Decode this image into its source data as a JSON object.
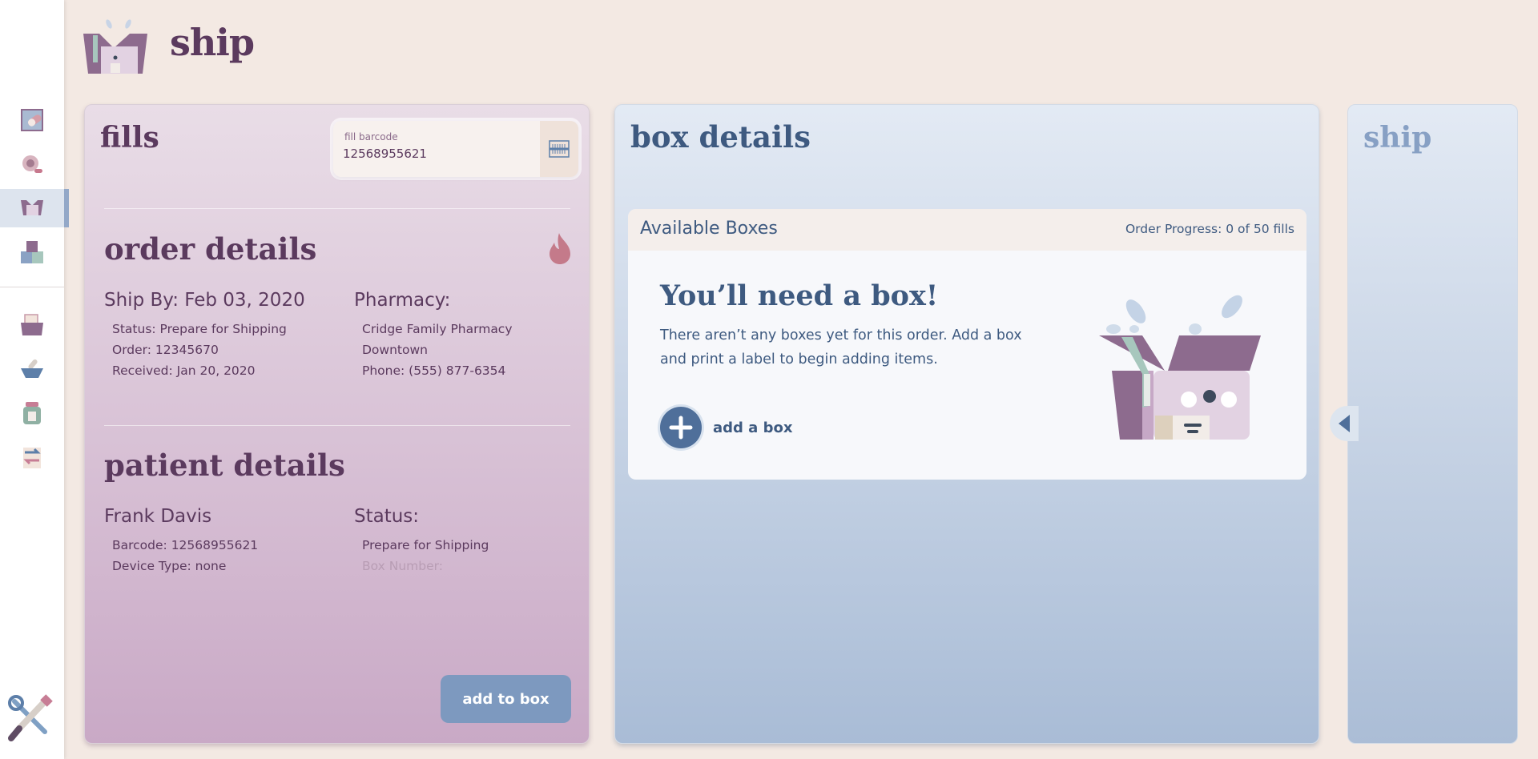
{
  "app": {
    "title": "ship"
  },
  "sidebar": {
    "items": [
      {
        "name": "nav-fill-icon",
        "active": false
      },
      {
        "name": "nav-search-icon",
        "active": false
      },
      {
        "name": "nav-ship-icon",
        "active": true
      },
      {
        "name": "nav-boxes-icon",
        "active": false
      },
      {
        "name": "nav-folder-icon",
        "active": false
      },
      {
        "name": "nav-mortar-icon",
        "active": false
      },
      {
        "name": "nav-bottle-icon",
        "active": false
      },
      {
        "name": "nav-transfer-icon",
        "active": false
      }
    ],
    "tools_icon": "tools-icon"
  },
  "fills": {
    "title": "fills",
    "barcode": {
      "label": "fill barcode",
      "value": "12568955621"
    },
    "order": {
      "title": "order details",
      "ship_by": "Ship By: Feb 03, 2020",
      "status": "Status: Prepare for Shipping",
      "order_no": "Order: 12345670",
      "received": "Received: Jan 20, 2020",
      "pharmacy_head": "Pharmacy:",
      "pharmacy_name": "Cridge Family Pharmacy",
      "pharmacy_loc": "Downtown",
      "pharmacy_phone": "Phone: (555) 877-6354"
    },
    "patient": {
      "title": "patient details",
      "name": "Frank Davis",
      "barcode": "Barcode: 12568955621",
      "device": "Device Type: none",
      "status_head": "Status:",
      "status": "Prepare for Shipping",
      "box_number": "Box Number:"
    },
    "add_to_box": "add to box"
  },
  "box_details": {
    "title": "box details",
    "available": {
      "title": "Available Boxes",
      "progress": "Order Progress: 0 of 50 fills",
      "need_title": "You’ll need a box!",
      "need_text": "There aren’t any boxes yet for this order. Add a box and print a label to begin adding items.",
      "add_label": "add a box"
    }
  },
  "ship_panel": {
    "title": "ship"
  },
  "colors": {
    "plum": "#5b3a5e",
    "navy": "#3e5a80",
    "button_blue": "#7d99bf",
    "background": "#f3e9e3"
  }
}
